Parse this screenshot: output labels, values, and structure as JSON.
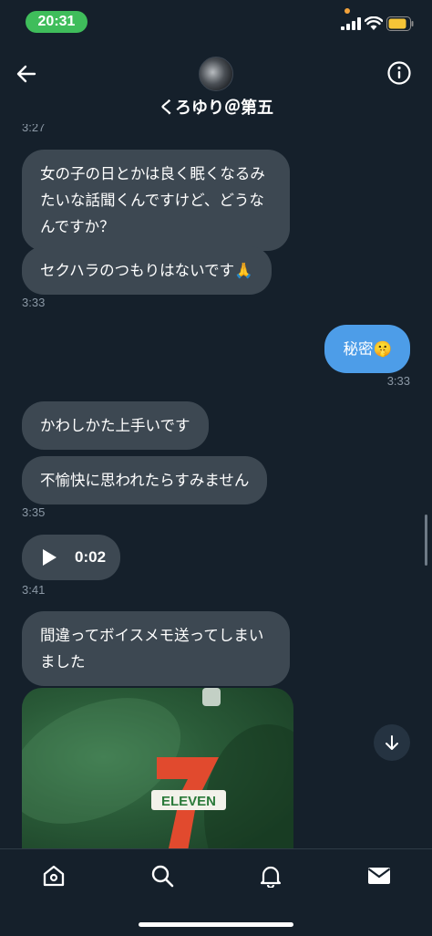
{
  "status_bar": {
    "time": "20:31",
    "accent": "#3fbd5b"
  },
  "header": {
    "contact_name": "くろゆり＠第五",
    "back_icon": "arrow-left-icon",
    "info_icon": "info-circle-icon"
  },
  "messages": [
    {
      "direction": "in",
      "text_lines": [
        "女の子の日とかは良く眠くなるみ",
        "たいな話聞くんですけど、どうな",
        "んですか？"
      ]
    },
    {
      "direction": "in",
      "text_lines": [
        "セクハラのつもりはないです🙏"
      ]
    },
    {
      "direction": "out",
      "text_lines": [
        "秘密🤫"
      ]
    },
    {
      "direction": "in",
      "text_lines": [
        "かわしかた上手いです"
      ]
    },
    {
      "direction": "in",
      "text_lines": [
        "不愉快に思われたらすみません"
      ]
    },
    {
      "direction": "in",
      "type": "voice",
      "duration": "0:02"
    },
    {
      "direction": "in",
      "text_lines": [
        "間違ってボイスメモ送ってしまい",
        "ました"
      ]
    },
    {
      "direction": "in",
      "type": "image",
      "image_text": "ELEVEN"
    }
  ],
  "timestamps": {
    "top_partial": "3:27",
    "t1": "3:33",
    "t2": "3:33",
    "t3": "3:35",
    "t4": "3:41"
  },
  "bottom_nav": {
    "items": [
      "home-icon",
      "search-icon",
      "bell-icon",
      "mail-icon"
    ]
  },
  "colors": {
    "background": "#15202b",
    "incoming_bubble": "#3d4852",
    "outgoing_bubble": "#4d9de8",
    "timestamp": "#8b98a5"
  }
}
